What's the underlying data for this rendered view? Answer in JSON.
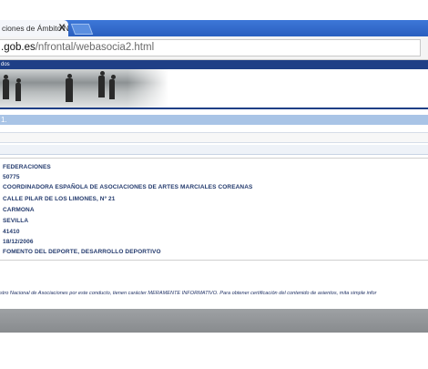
{
  "browser": {
    "tab_title": "ciones de Ámbito N",
    "close_glyph": "X",
    "address_domain": ".gob.es",
    "address_path": "/nfrontal/webasocia2.html"
  },
  "site": {
    "nav_text": "dos",
    "section_title": "1.",
    "banner_image": "photo-people-walking"
  },
  "record": {
    "fields": [
      "FEDERACIONES",
      "50775",
      "COORDINADORA ESPAÑOLA DE ASOCIACIONES DE ARTES MARCIALES COREANAS",
      "CALLE PILAR DE LOS LIMONES, Nº 21",
      "CARMONA",
      "SEVILLA",
      "41410",
      "18/12/2006",
      "FOMENTO DEL DEPORTE, DESARROLLO DEPORTIVO"
    ]
  },
  "disclaimer": "stro Nacional de Asociaciones por este conducto, tienen carácter MERAMENTE INFORMATIVO. Para obtener certificación del contenido de asientos, mita simple infor",
  "colors": {
    "tab_bar": "#2a5fbf",
    "site_navy": "#1f3f86",
    "section_blue": "#a9c4e6",
    "field_text": "#233a6d",
    "footer_gray": "#8f9295"
  }
}
